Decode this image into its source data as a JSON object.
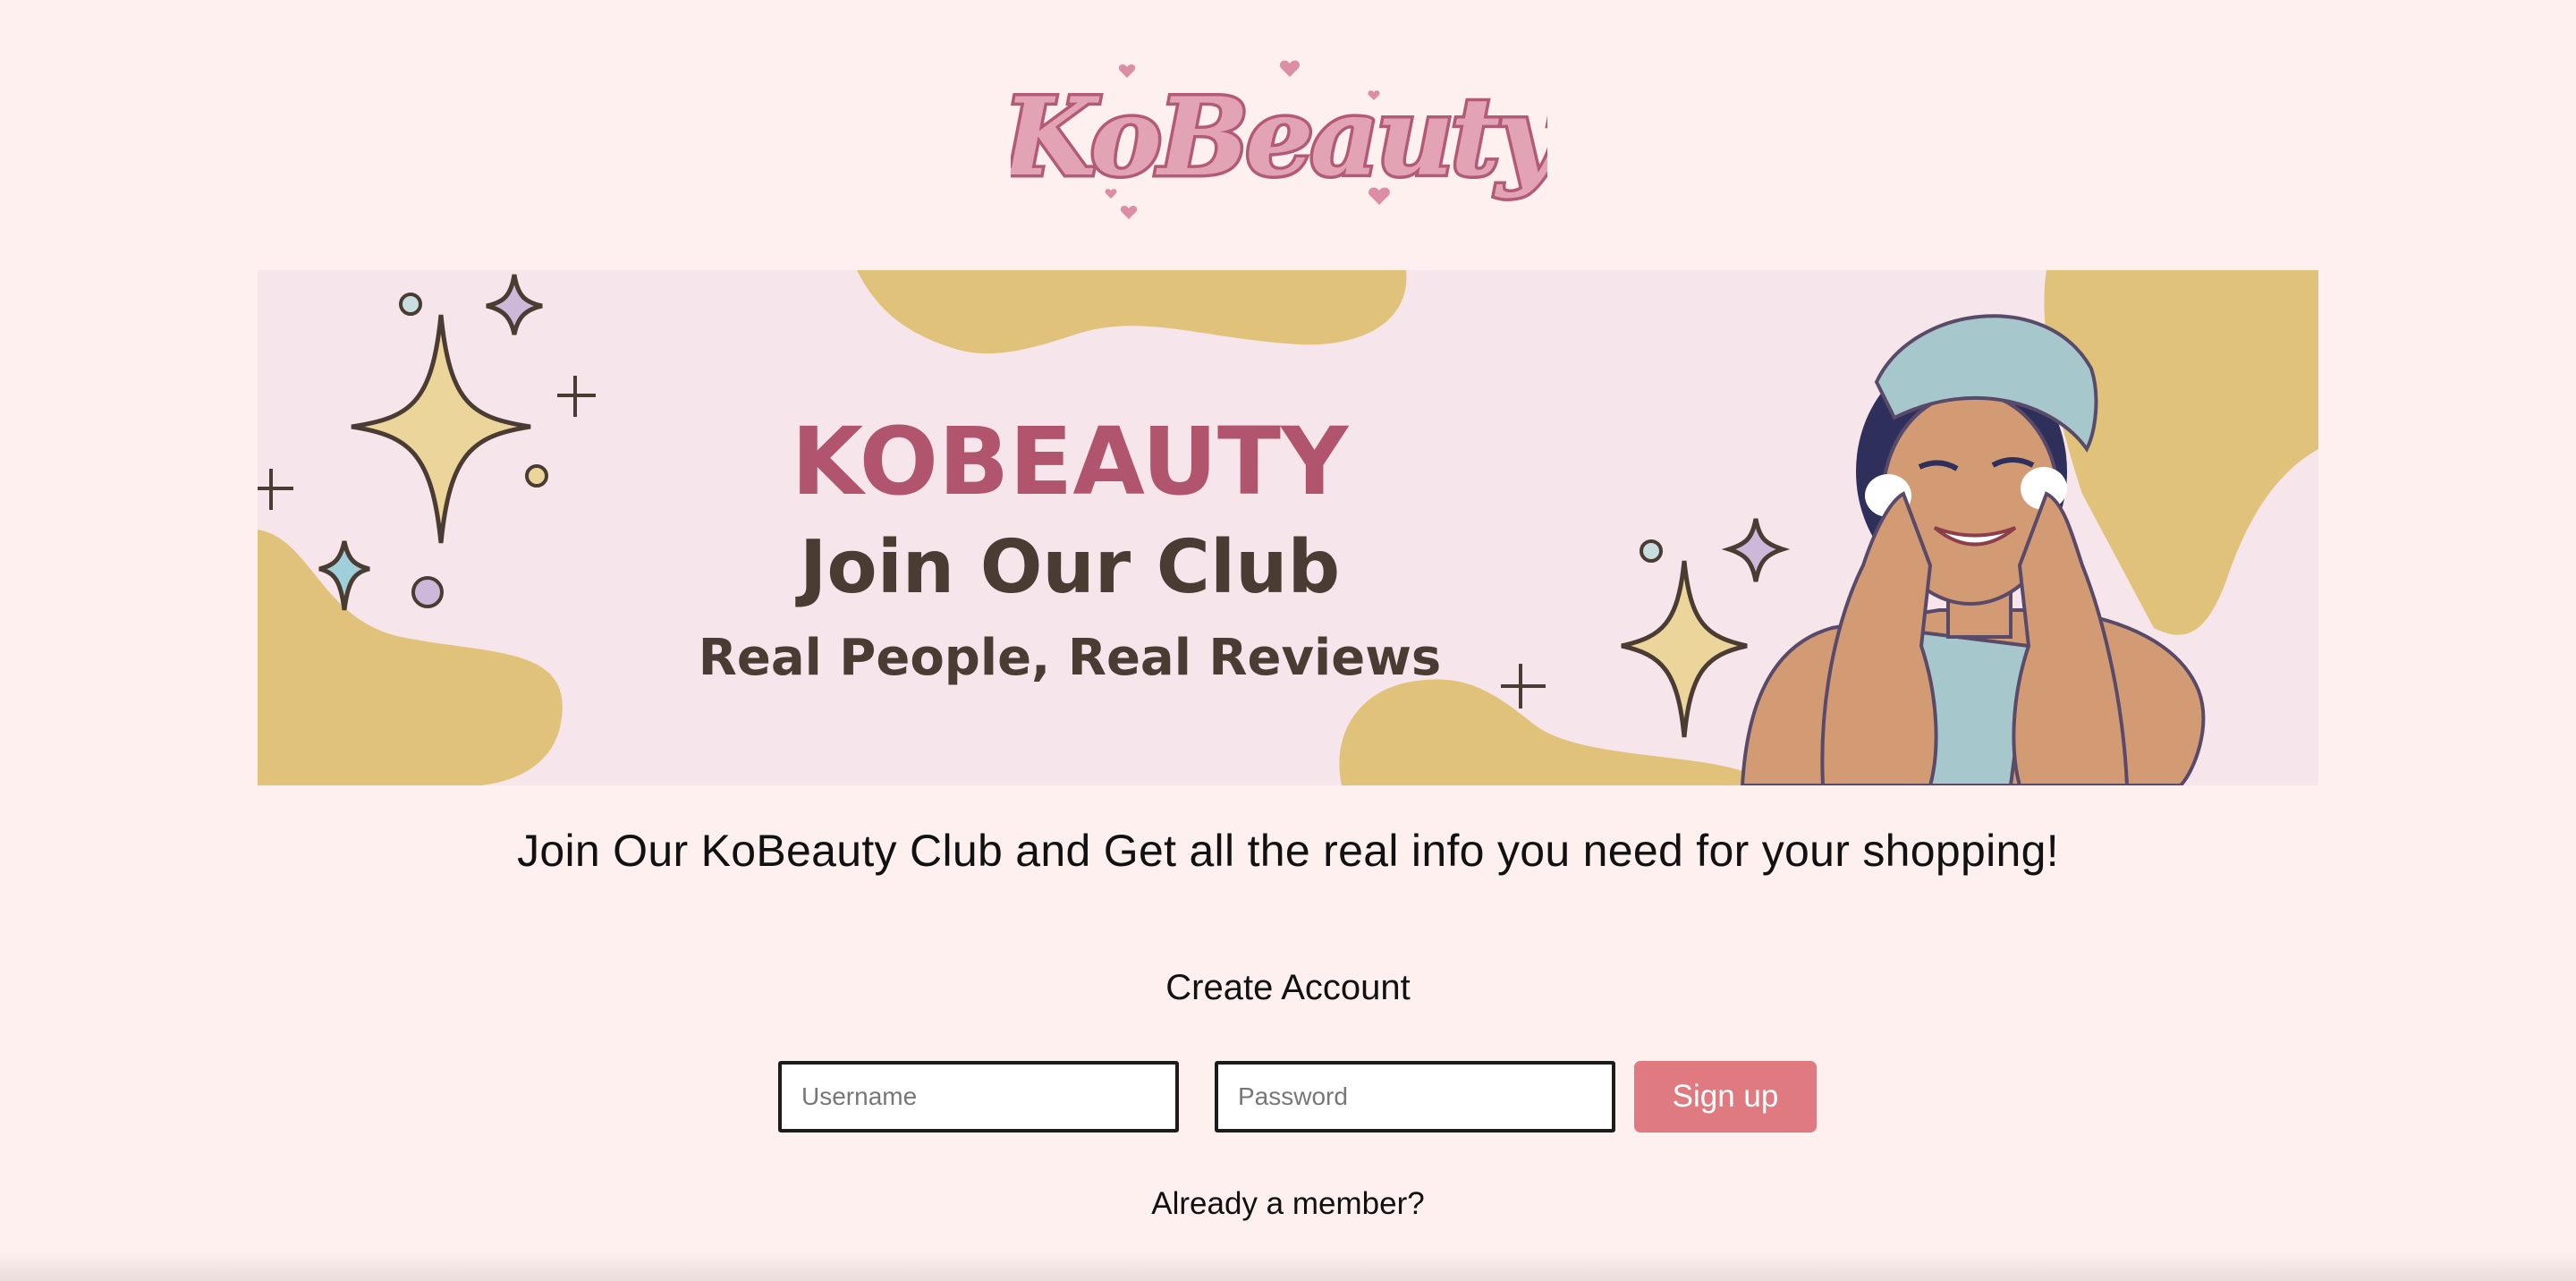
{
  "brand": {
    "logo_text": "KoBeauty"
  },
  "banner": {
    "headline": "KOBEAUTY",
    "subhead": "Join Our Club",
    "tagline": "Real People, Real Reviews"
  },
  "intro": {
    "text": "Join Our KoBeauty Club and Get all the real info you need for your shopping!"
  },
  "signup": {
    "title": "Create Account",
    "username_placeholder": "Username",
    "username_value": "",
    "password_placeholder": "Password",
    "password_value": "",
    "submit_label": "Sign up",
    "member_link": "Already a member?"
  },
  "colors": {
    "page_bg": "#fdf0ee",
    "brand_pink": "#df7a80",
    "logo_fill": "#e2a3b5",
    "logo_outline": "#b25a76",
    "banner_bg": "#f6e5ea",
    "banner_yellow": "#e1c27a",
    "headline_color": "#b0556d",
    "banner_text_dark": "#4a3b33"
  }
}
